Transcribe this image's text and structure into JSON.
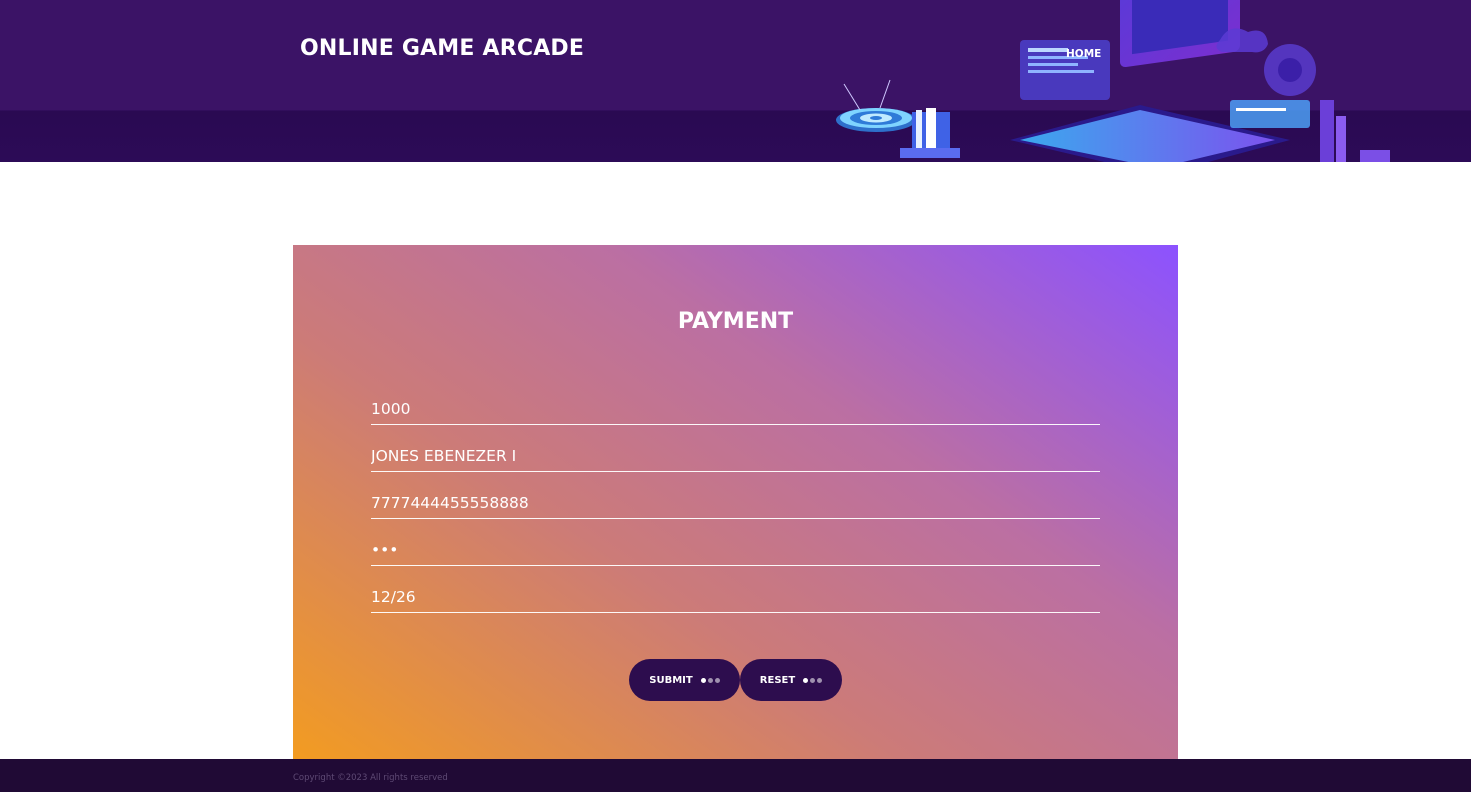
{
  "header": {
    "brand": "ONLINE GAME ARCADE",
    "nav": {
      "home_label": "HOME"
    }
  },
  "payment": {
    "title": "PAYMENT",
    "fields": [
      {
        "name": "amount",
        "value": "1000"
      },
      {
        "name": "card-holder",
        "value": "JONES EBENEZER I"
      },
      {
        "name": "card-number",
        "value": "7777444455558888"
      },
      {
        "name": "cvv",
        "value": "•••"
      },
      {
        "name": "expiry",
        "value": "12/26"
      }
    ],
    "submit_label": "SUBMIT",
    "reset_label": "RESET"
  },
  "footer": {
    "copyright": "Copyright ©2023 All rights reserved"
  },
  "colors": {
    "header_bg": "#3b1366",
    "button_bg": "#2d0d4e",
    "footer_bg": "#200a35",
    "gradient_top_right": "#8c52ff",
    "gradient_bottom_left": "#f39c20"
  }
}
